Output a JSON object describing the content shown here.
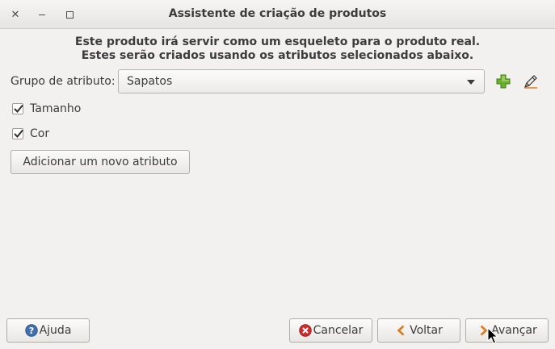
{
  "window": {
    "title": "Assistente de criação de produtos"
  },
  "description": {
    "line1": "Este produto irá servir como um esqueleto para o produto real.",
    "line2": "Estes serão criados usando os atributos selecionados abaixo."
  },
  "attribute_group": {
    "label": "Grupo de atributo:",
    "selected": "Sapatos",
    "add_icon": "plus-icon",
    "edit_icon": "pencil-icon"
  },
  "attributes": [
    {
      "label": "Tamanho",
      "checked": true
    },
    {
      "label": "Cor",
      "checked": true
    }
  ],
  "add_attribute_label": "Adicionar um novo atributo",
  "footer": {
    "help": "Ajuda",
    "cancel": "Cancelar",
    "back": "Voltar",
    "next": "Avançar"
  },
  "colors": {
    "help_icon": "#3f6fb0",
    "cancel_icon": "#cc2c2c",
    "arrow_icon": "#e07a1f",
    "add_icon": "#6ab12e"
  }
}
